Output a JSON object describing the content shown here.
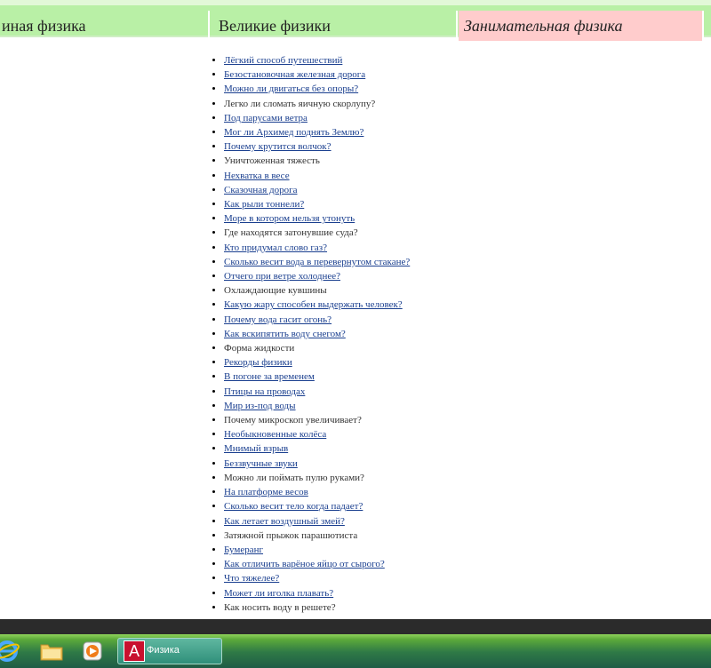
{
  "nav": {
    "tab1": "иная физика",
    "tab2": "Великие физики",
    "tab3": "Занимательная физика"
  },
  "links": [
    {
      "text": "Лёгкий способ путешествий",
      "link": true
    },
    {
      "text": "Безостановочная железная дорога",
      "link": true
    },
    {
      "text": "Можно ли двигаться без опоры?",
      "link": true
    },
    {
      "text": "Легко ли сломать яичную скорлупу?",
      "link": false
    },
    {
      "text": "Под парусами ветра",
      "link": true
    },
    {
      "text": "Мог ли Архимед поднять Землю?",
      "link": true
    },
    {
      "text": "Почему крутится волчок?",
      "link": true
    },
    {
      "text": "Уничтоженная тяжесть",
      "link": false
    },
    {
      "text": "Нехватка в весе",
      "link": true
    },
    {
      "text": "Сказочная дорога",
      "link": true
    },
    {
      "text": "Как рыли тоннели?",
      "link": true
    },
    {
      "text": "Море в котором нельзя утонуть",
      "link": true
    },
    {
      "text": "Где находятся затонувшие суда?",
      "link": false
    },
    {
      "text": "Кто придумал слово газ?",
      "link": true
    },
    {
      "text": "Сколько весит вода в перевернутом стакане?",
      "link": true
    },
    {
      "text": "Отчего при ветре холоднее?",
      "link": true
    },
    {
      "text": "Охлаждающие кувшины",
      "link": false
    },
    {
      "text": "Какую жару способен выдержать человек?",
      "link": true
    },
    {
      "text": "Почему вода гасит огонь?",
      "link": true
    },
    {
      "text": "Как вскипятить воду снегом?",
      "link": true
    },
    {
      "text": "Форма жидкости",
      "link": false
    },
    {
      "text": "Рекорды физики",
      "link": true
    },
    {
      "text": "В погоне за временем",
      "link": true
    },
    {
      "text": "Птицы на проводах",
      "link": true
    },
    {
      "text": "Мир из-под воды",
      "link": true
    },
    {
      "text": "Почему микроскоп увеличивает?",
      "link": false
    },
    {
      "text": "Необыкновенные колёса",
      "link": true
    },
    {
      "text": "Мнимый взрыв",
      "link": true
    },
    {
      "text": "Беззвучные звуки",
      "link": true
    },
    {
      "text": "Можно ли поймать пулю руками?",
      "link": false
    },
    {
      "text": "На платформе весов",
      "link": true
    },
    {
      "text": "Сколько весит тело когда падает?",
      "link": true
    },
    {
      "text": "Как летает воздушный змей?",
      "link": true
    },
    {
      "text": "Затяжной прыжок парашютиста",
      "link": false
    },
    {
      "text": "Бумеранг",
      "link": true
    },
    {
      "text": "Как отличить варёное яйцо от сырого?",
      "link": true
    },
    {
      "text": "Что тяжелее?",
      "link": true
    },
    {
      "text": "Может ли иголка плавать?",
      "link": true
    },
    {
      "text": "Как носить воду в решете?",
      "link": false
    }
  ],
  "taskbar": {
    "task_label": "Физика",
    "icons": [
      "internet-explorer-icon",
      "folder-icon",
      "media-player-icon"
    ],
    "app_icon_glyph": "A"
  }
}
